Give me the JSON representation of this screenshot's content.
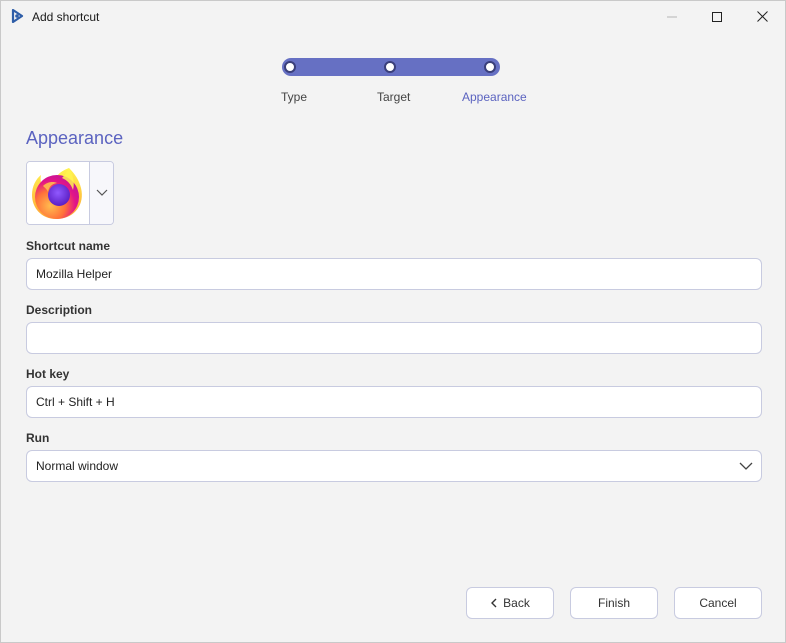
{
  "window": {
    "title": "Add shortcut"
  },
  "stepper": {
    "steps": [
      {
        "label": "Type"
      },
      {
        "label": "Target"
      },
      {
        "label": "Appearance"
      }
    ],
    "active_step": "Appearance"
  },
  "section": {
    "title": "Appearance"
  },
  "icon_picker": {
    "icon": "firefox-logo-icon",
    "dropdown_icon": "chevron-down-icon"
  },
  "fields": {
    "shortcut_name": {
      "label": "Shortcut name",
      "value": "Mozilla Helper"
    },
    "description": {
      "label": "Description",
      "value": ""
    },
    "hot_key": {
      "label": "Hot key",
      "value": "Ctrl + Shift + H"
    },
    "run": {
      "label": "Run",
      "value": "Normal window"
    }
  },
  "buttons": {
    "back": "Back",
    "finish": "Finish",
    "cancel": "Cancel"
  },
  "colors": {
    "accent": "#5b63c0",
    "stepper_track": "#6670c3",
    "border": "#c8cbe0",
    "background": "#f3f3f3"
  }
}
